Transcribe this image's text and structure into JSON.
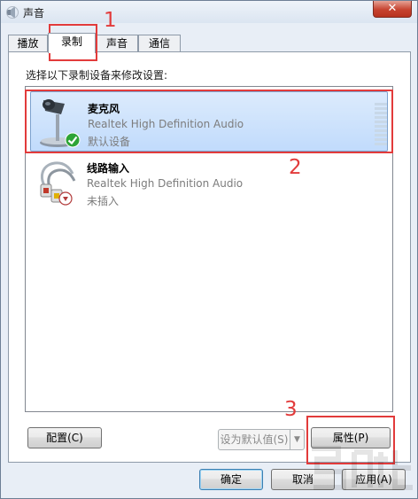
{
  "window": {
    "title": "声音",
    "title_icon": "speaker-icon",
    "close_label": "✕"
  },
  "tabs": [
    {
      "label": "播放",
      "active": false
    },
    {
      "label": "录制",
      "active": true
    },
    {
      "label": "声音",
      "active": false
    },
    {
      "label": "通信",
      "active": false
    }
  ],
  "instruction": "选择以下录制设备来修改设置:",
  "devices": [
    {
      "name": "麦克风",
      "description": "Realtek High Definition Audio",
      "status": "默认设备",
      "icon": "microphone-icon",
      "badge_icon": "check-badge-icon",
      "selected": true
    },
    {
      "name": "线路输入",
      "description": "Realtek High Definition Audio",
      "status": "未插入",
      "icon": "rca-cable-icon",
      "badge_icon": "unplugged-badge-icon",
      "selected": false
    }
  ],
  "buttons": {
    "configure": "配置(C)",
    "set_default": "设为默认值(S)",
    "set_default_arrow": "▼",
    "properties": "属性(P)",
    "ok": "确定",
    "cancel": "取消",
    "apply": "应用(A)"
  },
  "annotations": {
    "step1": "1",
    "step2": "2",
    "step3": "3",
    "color": "#e23b3b"
  },
  "colors": {
    "selection_fill": "#c1dbfc",
    "selection_border": "#7da2ce",
    "window_frame": "#e8eef6"
  }
}
